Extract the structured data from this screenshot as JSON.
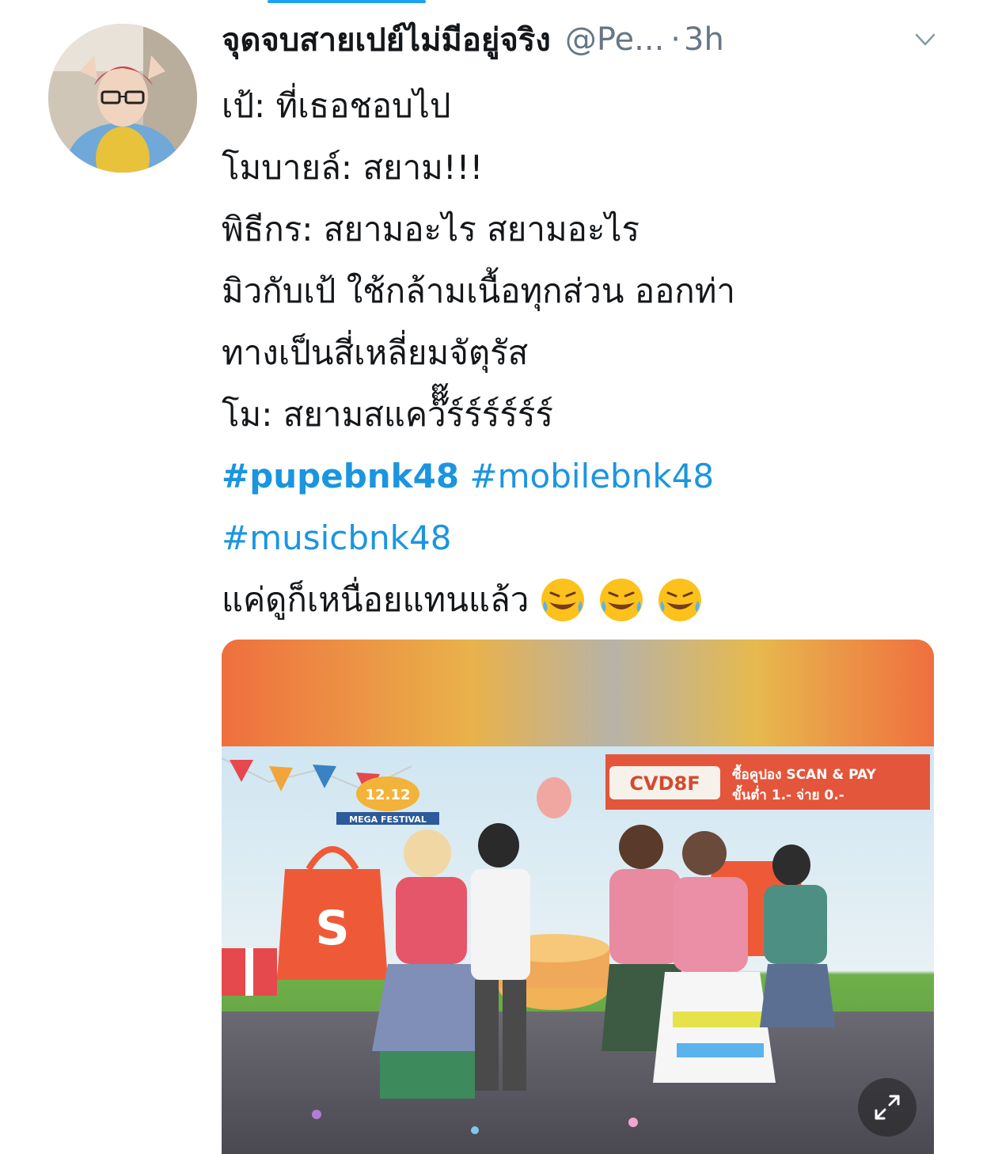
{
  "tweet": {
    "display_name": "จุดจบสายเปย์ไม่มีอยู่จริง",
    "handle": "@Pe...",
    "separator": "·",
    "time": "3h",
    "lines": [
      "เป้: ที่เธอชอบไป",
      "โมบายล์: สยาม!!!",
      "พิธีกร: สยามอะไร สยามอะไร",
      "มิวกับเป้ ใช้กล้ามเนื้อทุกส่วน ออกท่า",
      "ทางเป็นสี่เหลี่ยมจัตุรัส",
      "โม: สยามสแคว๊๊๊ร์ร์ร์ร์ร์ร์"
    ],
    "hashtags": [
      "#pupebnk48",
      "#mobilebnk48",
      "#musicbnk48"
    ],
    "last_line": "แค่ดูก็เหนื่อยแทนแล้ว",
    "emojis": [
      "rolling-on-floor-laughing-emoji",
      "rolling-on-floor-laughing-emoji",
      "rolling-on-floor-laughing-emoji"
    ]
  },
  "media": {
    "banner_code": "CVD8F",
    "banner_text_1": "ซื้อคูปอง SCAN & PAY",
    "banner_text_2": "ขั้นต่ำ 1.- จ่าย 0.-",
    "logo_top": "12.12",
    "logo_bottom": "MEGA FESTIVAL",
    "bag_letter": "S"
  },
  "colors": {
    "link": "#1b95e0",
    "muted": "#657786",
    "media_orange": "#f07a4a"
  }
}
